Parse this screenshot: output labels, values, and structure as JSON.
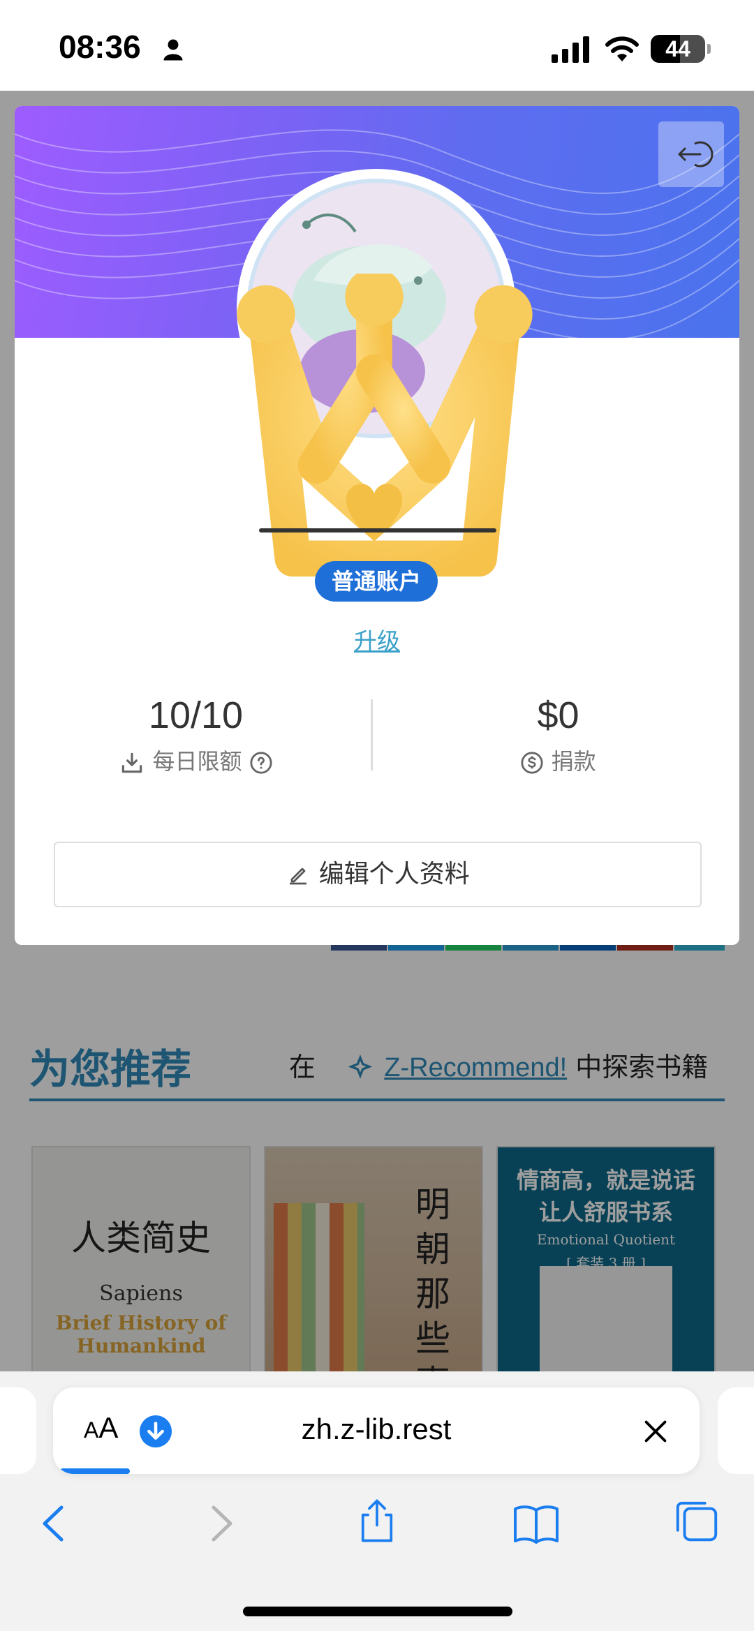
{
  "status_bar": {
    "time": "08:36",
    "battery": "44"
  },
  "recommend": {
    "title": "为您推荐",
    "explore_prefix": "在",
    "explore_link": "Z-Recommend!",
    "explore_suffix": "中探索书籍"
  },
  "books": [
    {
      "title": "人类简史",
      "subtitle": "Sapiens",
      "english": "Brief History of Humankind"
    },
    {
      "title": "明朝那些事儿"
    },
    {
      "title": "情商高，就是说话让人舒服书系",
      "english": "Emotional Quotient",
      "note": "[ 套装 3 册 ]"
    }
  ],
  "profile": {
    "badge": "普通账户",
    "upgrade": "升级",
    "stats": [
      {
        "value": "10/10",
        "label": "每日限额",
        "icon": "download-icon"
      },
      {
        "value": "$0",
        "label": "捐款",
        "icon": "dollar-icon"
      }
    ],
    "edit_button": "编辑个人资料"
  },
  "browser": {
    "aa_small": "A",
    "aa_large": "A",
    "url": "zh.z-lib.rest",
    "load_progress": 0.11
  },
  "colors": {
    "accent": "#2f8ab8",
    "badge": "#1e6fd8",
    "ios_blue": "#1a7df0"
  }
}
